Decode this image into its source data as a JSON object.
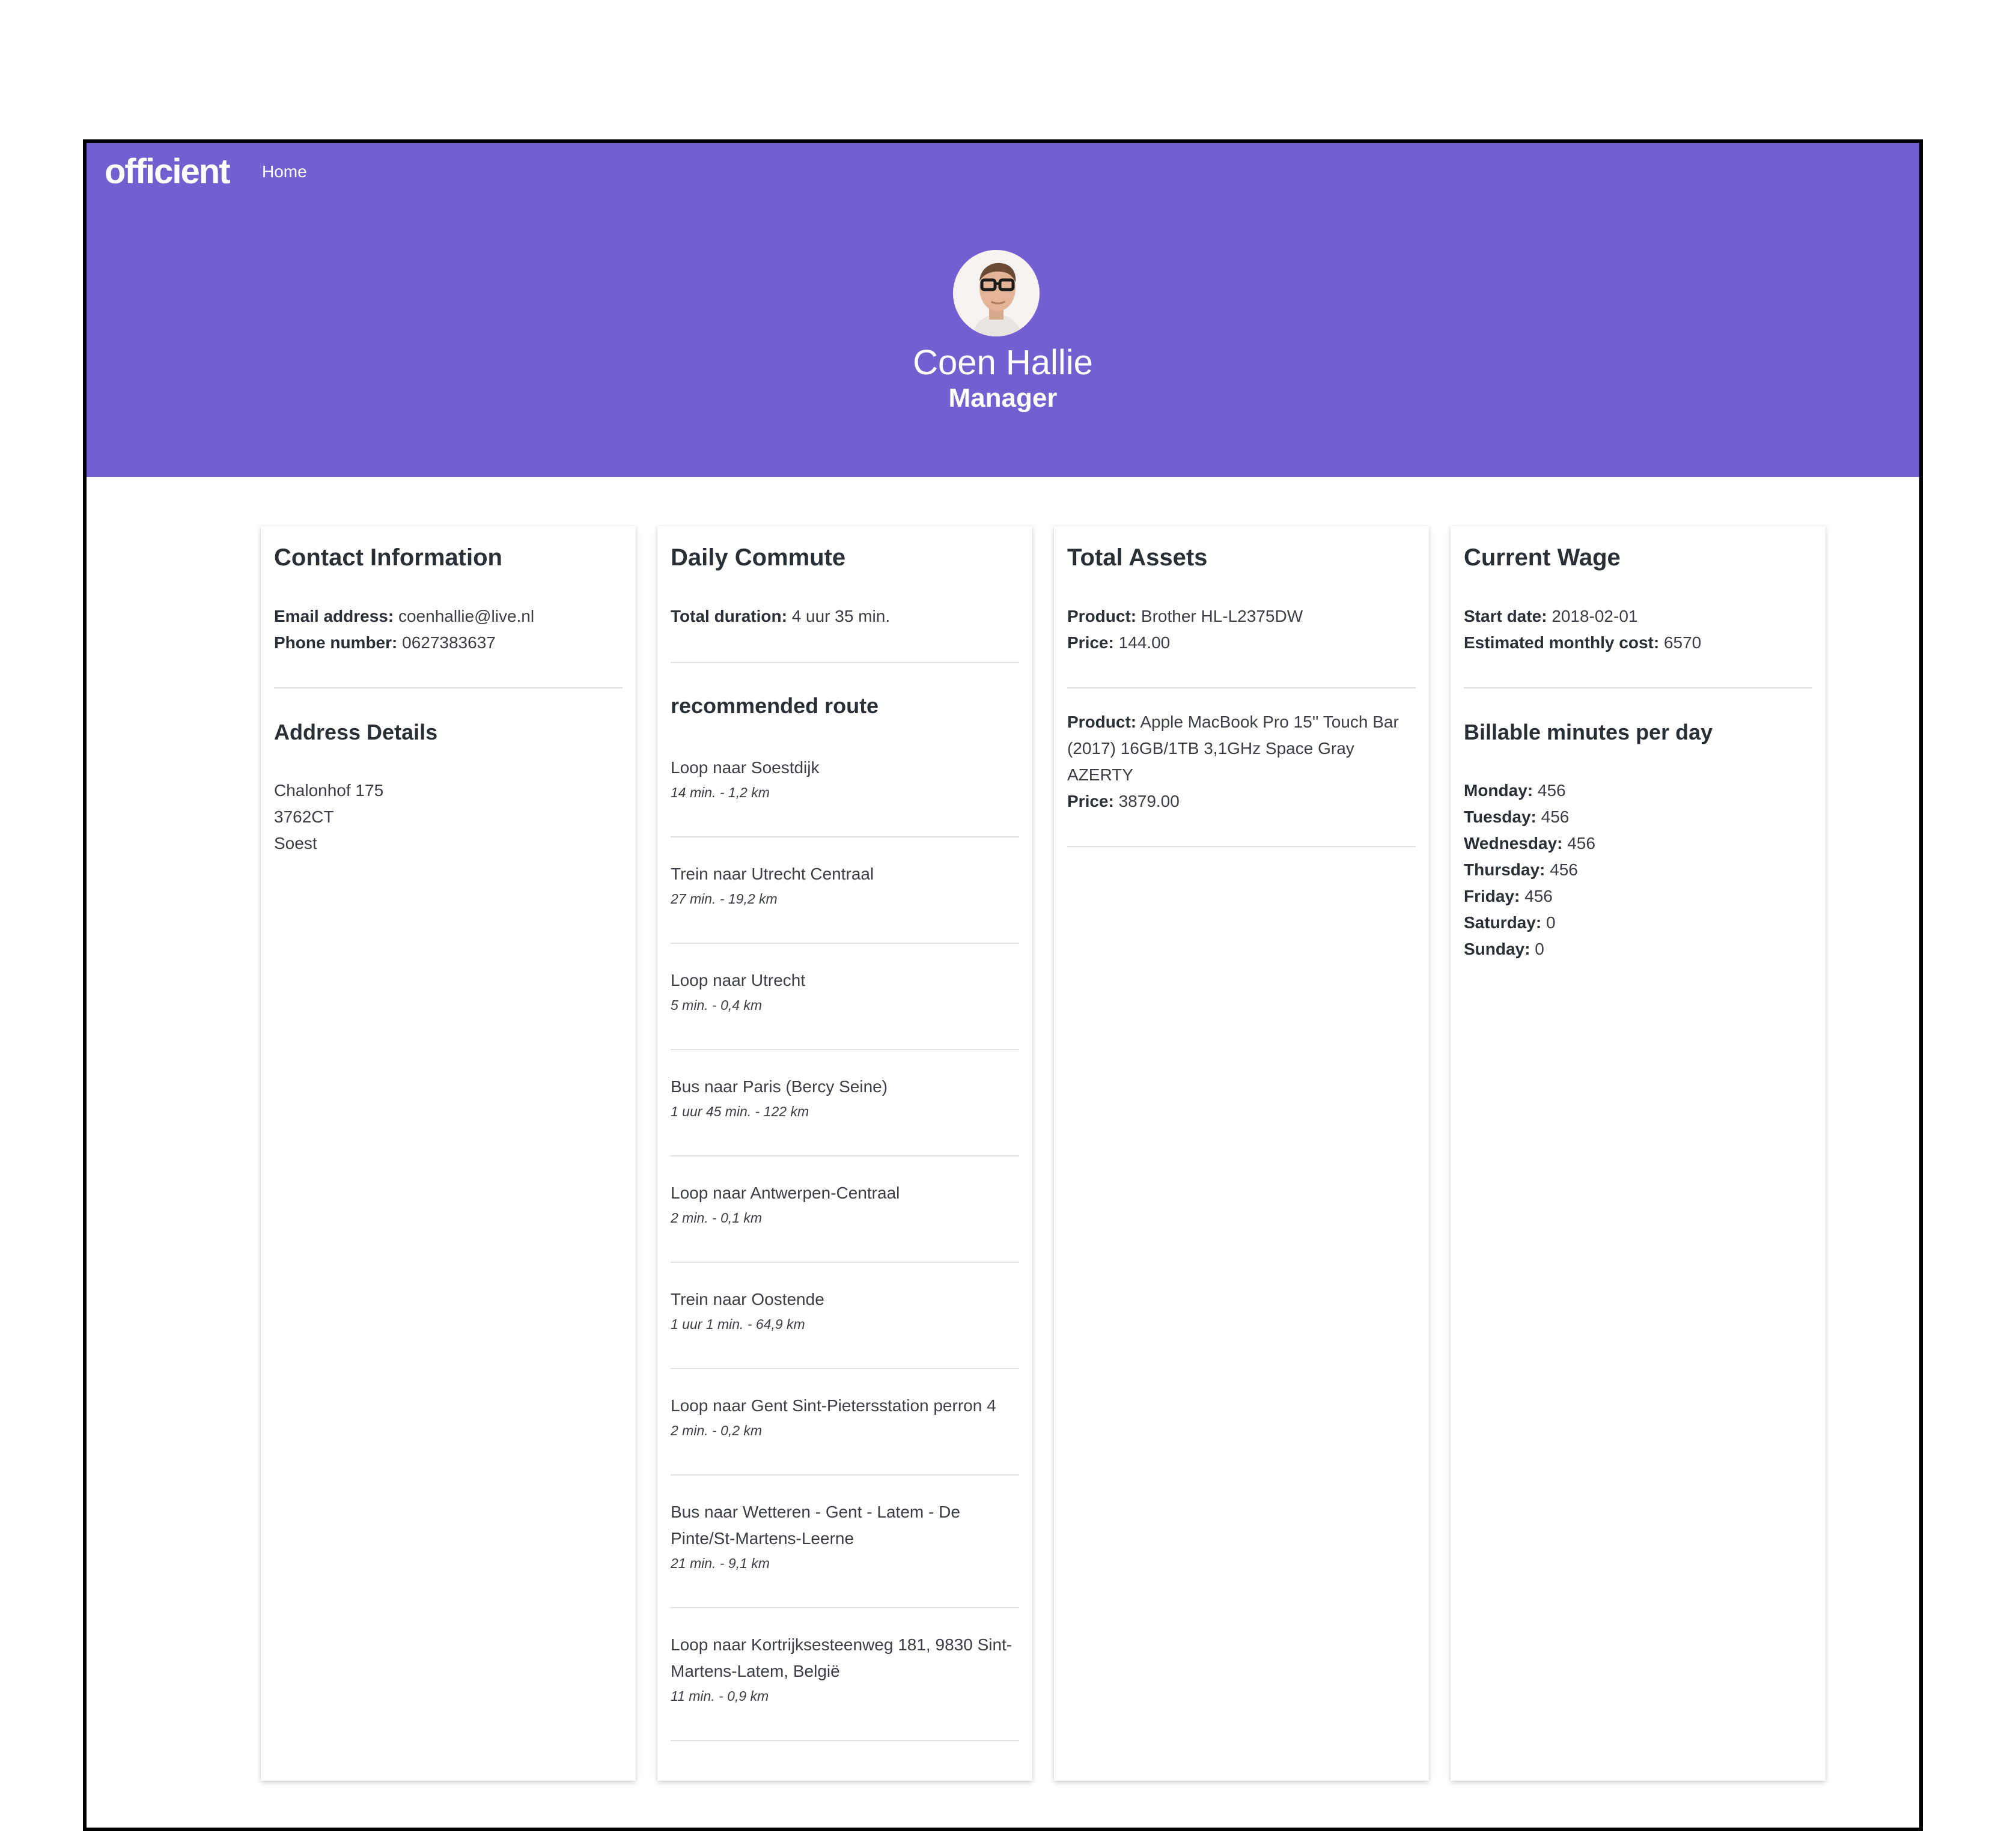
{
  "nav": {
    "logo": "officient",
    "home": "Home"
  },
  "profile": {
    "name": "Coen Hallie",
    "role": "Manager"
  },
  "contact": {
    "title": "Contact Information",
    "email_label": "Email address:",
    "email": "coenhallie@live.nl",
    "phone_label": "Phone number:",
    "phone": "0627383637",
    "address_title": "Address Details",
    "street": "Chalonhof 175",
    "postcode": "3762CT",
    "city": "Soest"
  },
  "commute": {
    "title": "Daily Commute",
    "duration_label": "Total duration:",
    "duration": "4 uur 35 min.",
    "route_title": "recommended route",
    "steps": [
      {
        "title": "Loop naar Soestdijk",
        "meta": "14 min. - 1,2 km"
      },
      {
        "title": "Trein naar Utrecht Centraal",
        "meta": "27 min. - 19,2 km"
      },
      {
        "title": "Loop naar Utrecht",
        "meta": "5 min. - 0,4 km"
      },
      {
        "title": "Bus naar Paris (Bercy Seine)",
        "meta": "1 uur 45 min. - 122 km"
      },
      {
        "title": "Loop naar Antwerpen-Centraal",
        "meta": "2 min. - 0,1 km"
      },
      {
        "title": "Trein naar Oostende",
        "meta": "1 uur 1 min. - 64,9 km"
      },
      {
        "title": "Loop naar Gent Sint-Pietersstation perron 4",
        "meta": "2 min. - 0,2 km"
      },
      {
        "title": "Bus naar Wetteren - Gent - Latem - De Pinte/St-Martens-Leerne",
        "meta": "21 min. - 9,1 km"
      },
      {
        "title": "Loop naar Kortrijksesteenweg 181, 9830 Sint-Martens-Latem, België",
        "meta": "11 min. - 0,9 km"
      }
    ]
  },
  "assets": {
    "title": "Total Assets",
    "product_label": "Product:",
    "price_label": "Price:",
    "items": [
      {
        "product": "Brother HL-L2375DW",
        "price": "144.00"
      },
      {
        "product": "Apple MacBook Pro 15'' Touch Bar (2017) 16GB/1TB 3,1GHz Space Gray AZERTY",
        "price": "3879.00"
      }
    ]
  },
  "wage": {
    "title": "Current Wage",
    "start_label": "Start date:",
    "start": "2018-02-01",
    "cost_label": "Estimated monthly cost:",
    "cost": "6570",
    "billable_title": "Billable minutes per day",
    "days": [
      {
        "label": "Monday:",
        "value": "456"
      },
      {
        "label": "Tuesday:",
        "value": "456"
      },
      {
        "label": "Wednesday:",
        "value": "456"
      },
      {
        "label": "Thursday:",
        "value": "456"
      },
      {
        "label": "Friday:",
        "value": "456"
      },
      {
        "label": "Saturday:",
        "value": "0"
      },
      {
        "label": "Sunday:",
        "value": "0"
      }
    ]
  }
}
